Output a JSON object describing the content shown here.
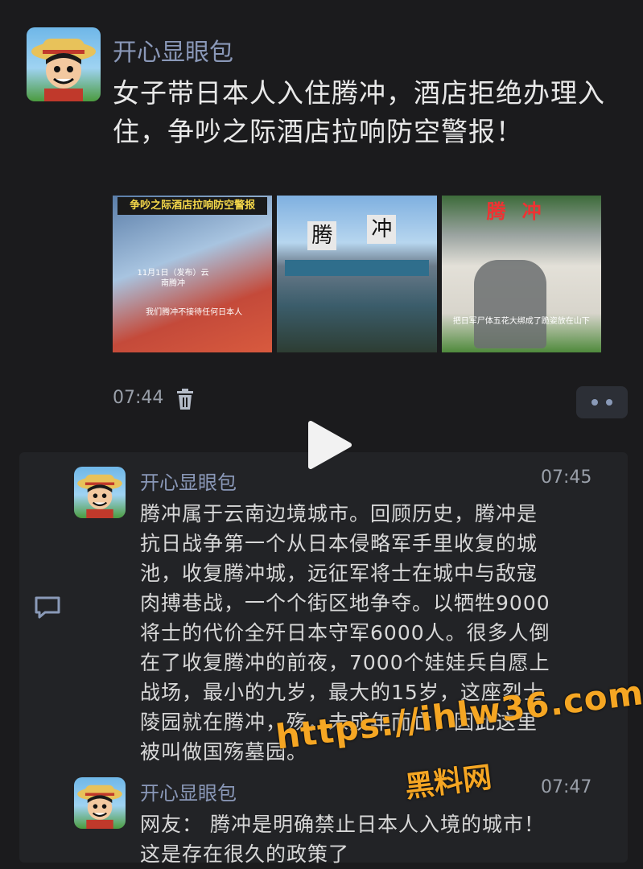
{
  "post": {
    "author": "开心显眼包",
    "title": "女子带日本人入住腾冲，酒店拒绝办理入住，争吵之际酒店拉响防空警报！",
    "time": "07:44",
    "thumbnails": [
      {
        "caption_top": "争吵之际酒店拉响防空警报",
        "caption_mid": "11月1日（发布）云南腾冲",
        "caption_bottom": "我们腾冲不接待任何日本人"
      },
      {
        "sign_left": "腾",
        "sign_right": "冲"
      },
      {
        "sign": "腾冲",
        "caption_bottom": "把日军尸体五花大绑成了跪姿放在山下"
      }
    ]
  },
  "comments": [
    {
      "author": "开心显眼包",
      "time": "07:45",
      "text_lines": [
        "腾冲属于云南边境城市。回顾历史，腾冲是",
        "抗日战争第一个从日本侵略军手里收复的城",
        "池，收复腾冲城，远征军将士在城中与敌寇",
        "肉搏巷战，一个个街区地争夺。以牺牲9000",
        "将士的代价全歼日本守军6000人。很多人倒",
        "在了收复腾冲的前夜，7000个娃娃兵自愿上",
        "战场，最小的九岁，最大的15岁，这座烈士",
        "陵园就在腾冲，殇，未成年而亡，因此这里",
        "被叫做国殇墓园。"
      ]
    },
    {
      "author": "开心显眼包",
      "time": "07:47",
      "text_lines": [
        "网友：  腾冲是明确禁止日本人入境的城市！",
        "这是存在很久的政策了"
      ]
    }
  ],
  "watermark": {
    "url": "https://ihlw36.com",
    "name": "黑料网"
  },
  "icons": [
    "avatar",
    "trash-icon",
    "more-icon",
    "play-icon",
    "comment-icon"
  ]
}
